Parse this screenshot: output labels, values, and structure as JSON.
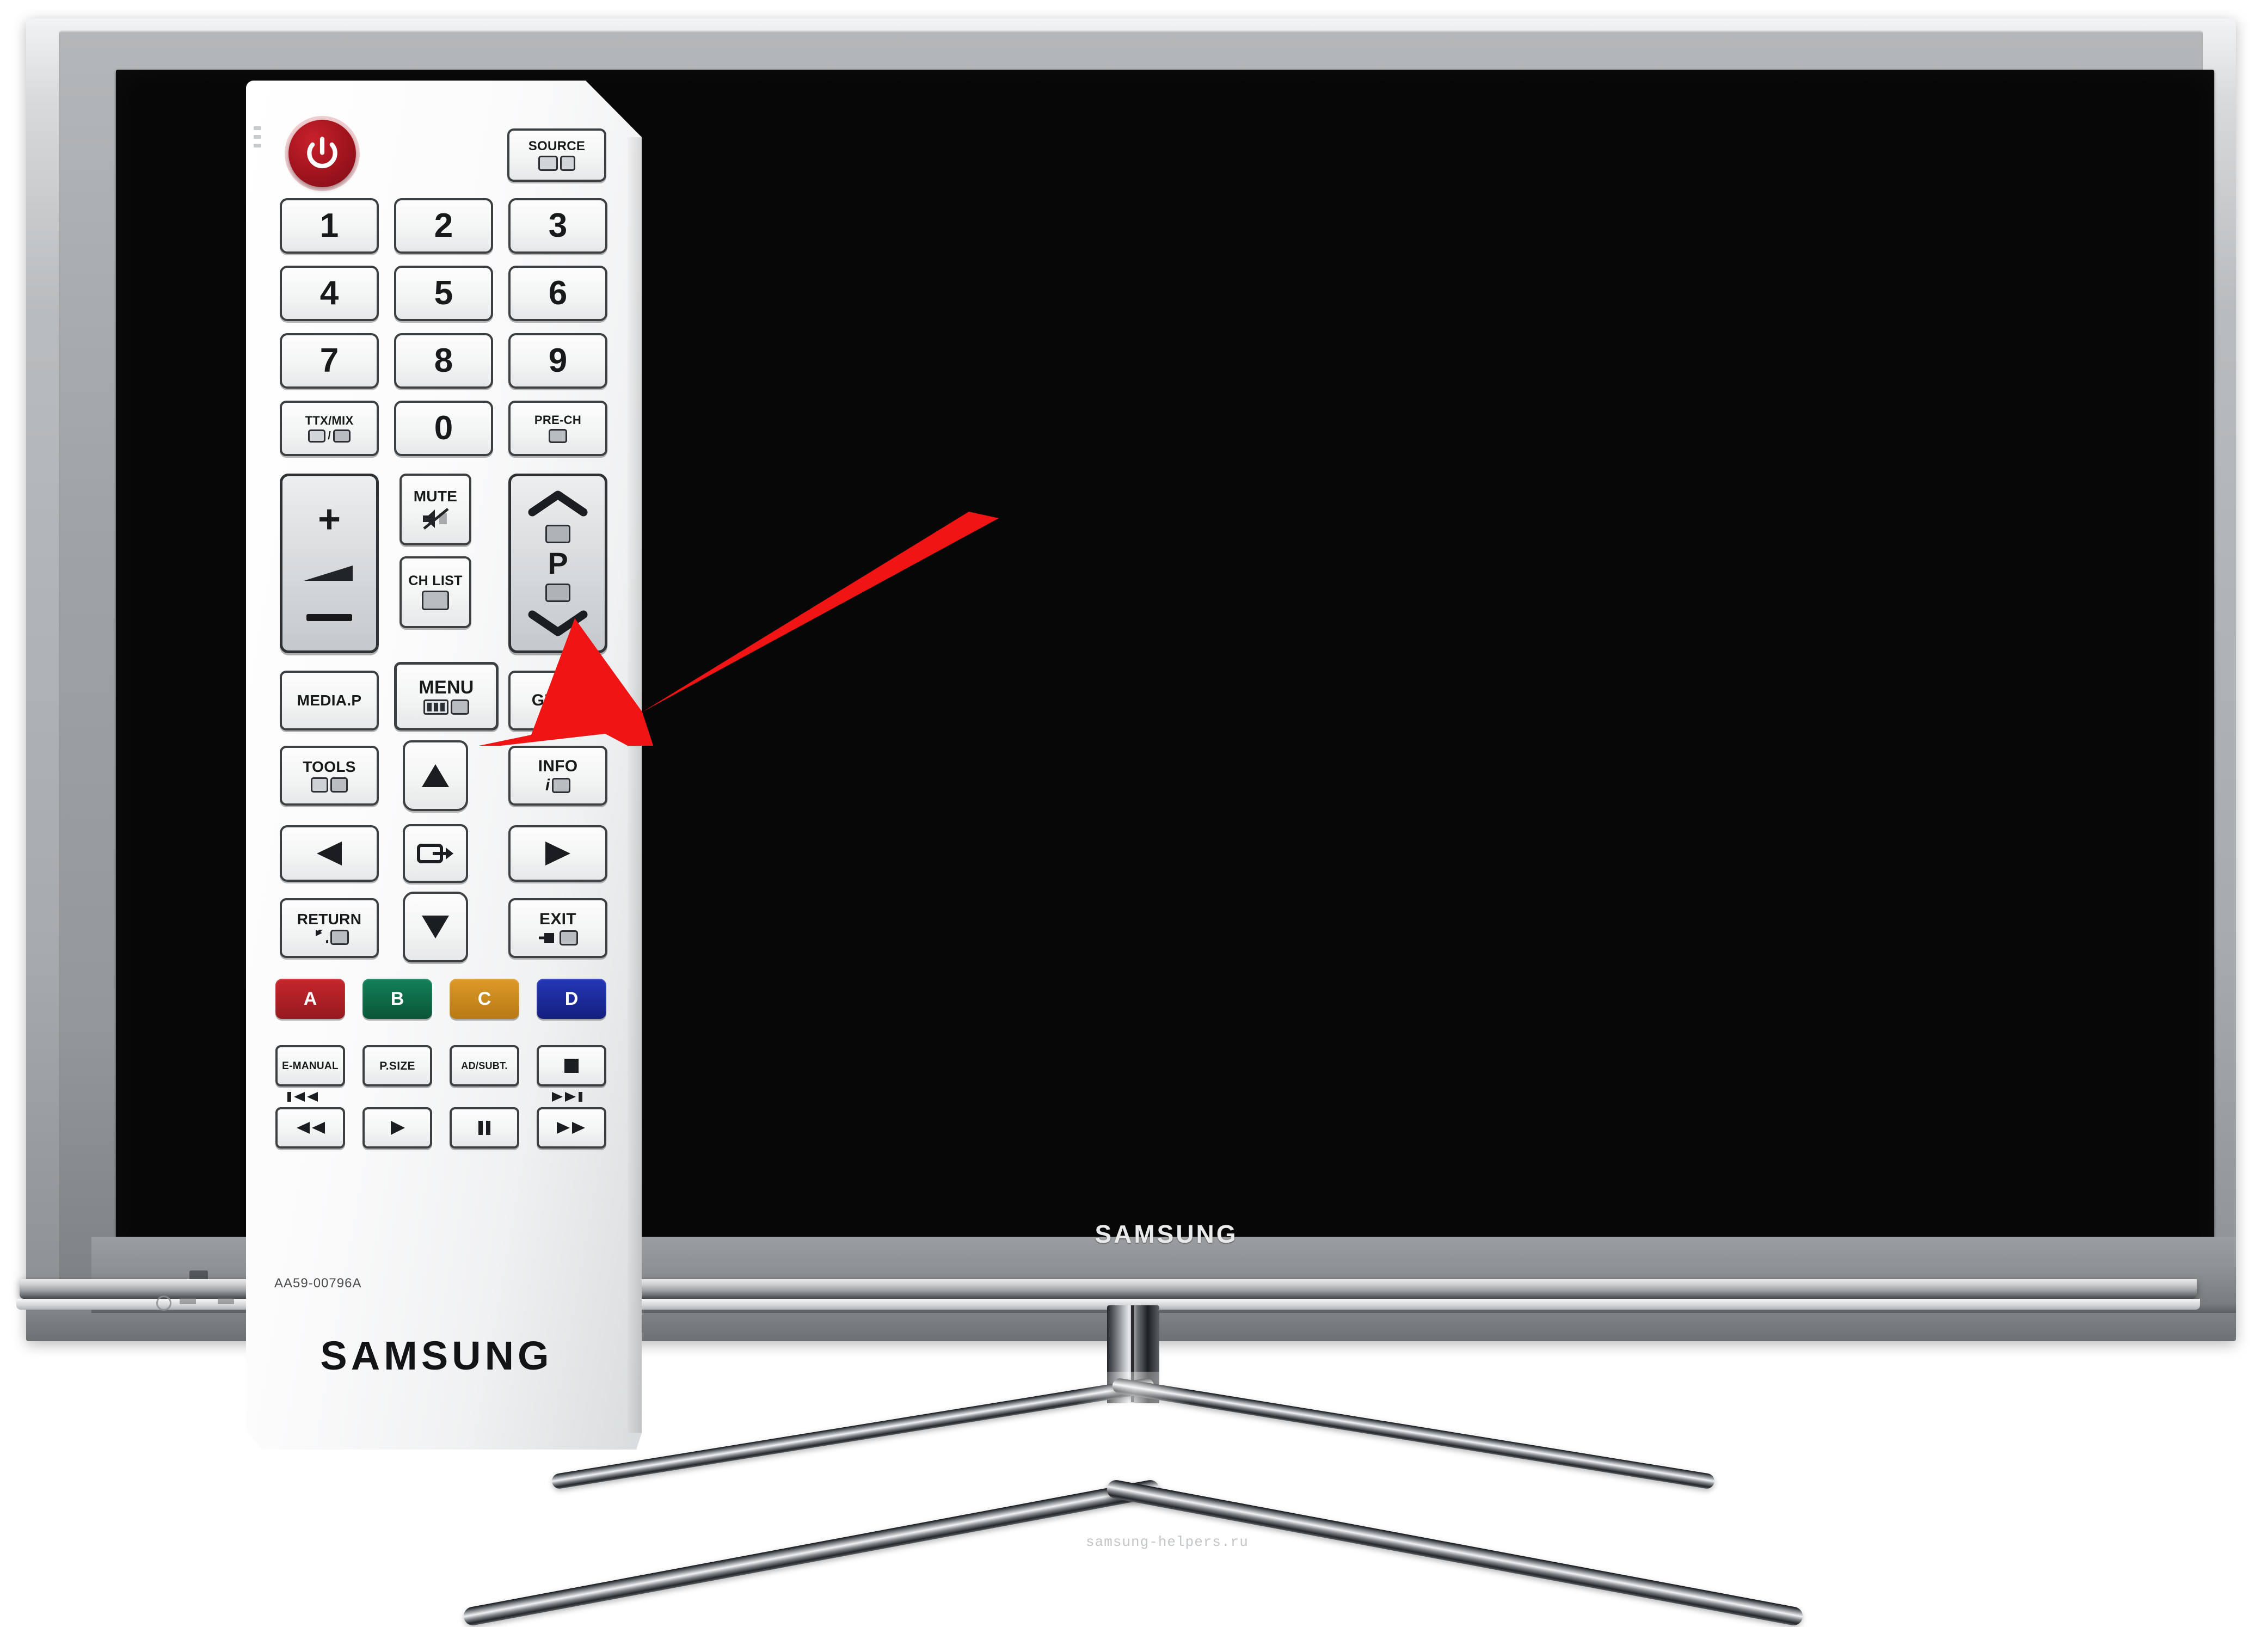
{
  "scene": {
    "description": "Samsung flat-screen TV with a white Samsung remote control overlaid and a red arrow pointing at the MENU button",
    "tv_brand": "SAMSUNG",
    "remote_brand": "SAMSUNG",
    "remote_model_code": "AA59-00796A",
    "watermark": "samsung-helpers.ru"
  },
  "colors": {
    "arrow": "#F01414",
    "power_red": "#A5151F",
    "key_a": "#B32025",
    "key_b": "#0E6B47",
    "key_c": "#CC8A1E",
    "key_d": "#1B2EA0",
    "screen_black": "#070707",
    "bezel_gray": "#9FA3A5"
  },
  "remote": {
    "power_label": "power-icon",
    "source": {
      "label": "SOURCE"
    },
    "numbers": [
      {
        "label": "1"
      },
      {
        "label": "2"
      },
      {
        "label": "3"
      },
      {
        "label": "4"
      },
      {
        "label": "5"
      },
      {
        "label": "6"
      },
      {
        "label": "7"
      },
      {
        "label": "8"
      },
      {
        "label": "9"
      }
    ],
    "ttx": {
      "label": "TTX/MIX"
    },
    "zero": {
      "label": "0"
    },
    "prech": {
      "label": "PRE-CH"
    },
    "volume": {
      "plus": "+",
      "minus": "−"
    },
    "mute": {
      "label": "MUTE"
    },
    "chlist": {
      "label": "CH LIST"
    },
    "program": {
      "label": "P"
    },
    "media_p": {
      "label": "MEDIA.P"
    },
    "menu": {
      "label": "MENU"
    },
    "guide": {
      "label": "GUIDE"
    },
    "tools": {
      "label": "TOOLS"
    },
    "info": {
      "label": "INFO"
    },
    "up": {
      "label": "up-arrow-icon"
    },
    "down": {
      "label": "down-arrow-icon"
    },
    "left": {
      "label": "left-arrow-icon"
    },
    "right": {
      "label": "right-arrow-icon"
    },
    "enter": {
      "label": "enter-icon"
    },
    "return": {
      "label": "RETURN"
    },
    "exit": {
      "label": "EXIT"
    },
    "color_keys": [
      {
        "label": "A",
        "color": "#B32025"
      },
      {
        "label": "B",
        "color": "#0E6B47"
      },
      {
        "label": "C",
        "color": "#CC8A1E"
      },
      {
        "label": "D",
        "color": "#1B2EA0"
      }
    ],
    "media_row": [
      {
        "label": "E-MANUAL"
      },
      {
        "label": "P.SIZE"
      },
      {
        "label": "AD/SUBT."
      },
      {
        "label": "stop-icon"
      }
    ],
    "transport_row": [
      {
        "label": "rewind-icon"
      },
      {
        "label": "play-icon"
      },
      {
        "label": "pause-icon"
      },
      {
        "label": "fast-forward-icon"
      }
    ],
    "prev_track": "previous-track-icon",
    "next_track": "next-track-icon",
    "model_code": "AA59-00796A",
    "brand": "SAMSUNG"
  },
  "tv": {
    "brand": "SAMSUNG"
  },
  "annotation": {
    "arrow_target": "MENU",
    "arrow_color": "#F01414"
  }
}
